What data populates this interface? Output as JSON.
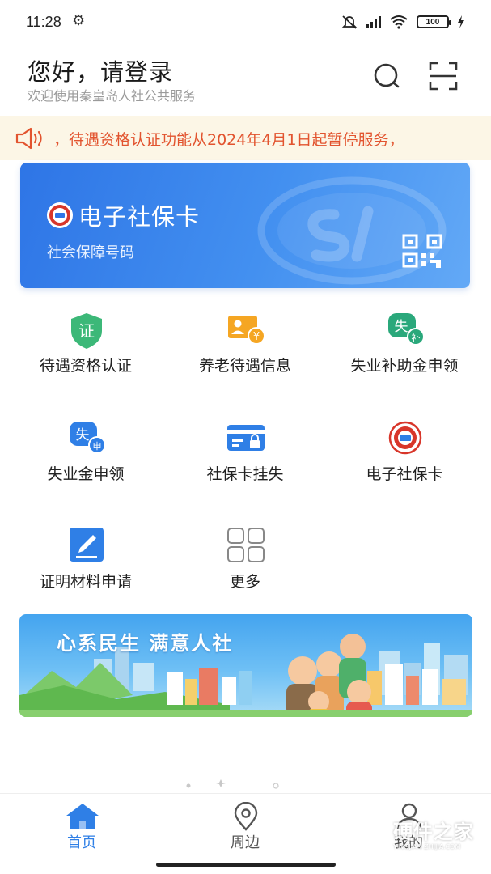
{
  "status_bar": {
    "time": "11:28",
    "battery": "100"
  },
  "header": {
    "greeting": "您好，请登录",
    "subtitle": "欢迎使用秦皇岛人社公共服务"
  },
  "notice": {
    "text": "，待遇资格认证功能从2024年4月1日起暂停服务，"
  },
  "social_card": {
    "title": "电子社保卡",
    "subtitle": "社会保障号码"
  },
  "services": [
    {
      "label": "待遇资格认证",
      "icon": "certificate-shield-icon"
    },
    {
      "label": "养老待遇信息",
      "icon": "pension-info-icon"
    },
    {
      "label": "失业补助金申领",
      "icon": "unemployment-subsidy-icon"
    },
    {
      "label": "失业金申领",
      "icon": "unemployment-benefit-icon"
    },
    {
      "label": "社保卡挂失",
      "icon": "card-lock-icon"
    },
    {
      "label": "电子社保卡",
      "icon": "social-security-emblem-icon"
    },
    {
      "label": "证明材料申请",
      "icon": "edit-document-icon"
    },
    {
      "label": "更多",
      "icon": "grid-more-icon"
    }
  ],
  "promo": {
    "text": "心系民生  满意人社"
  },
  "tabs": [
    {
      "label": "首页",
      "icon": "home-icon",
      "active": true
    },
    {
      "label": "周边",
      "icon": "location-pin-icon",
      "active": false
    },
    {
      "label": "我的",
      "icon": "user-icon",
      "active": false
    }
  ],
  "watermark": {
    "title": "硬件之家",
    "subtitle": "YINGJIAN ZHIJIA.COM"
  },
  "colors": {
    "accent": "#2f7fe6",
    "notice_text": "#e2542f",
    "notice_bg": "#fcf6e6",
    "card_blue": "#3b86ec",
    "green": "#3cb878",
    "orange": "#f5a623",
    "red": "#d8362a"
  }
}
